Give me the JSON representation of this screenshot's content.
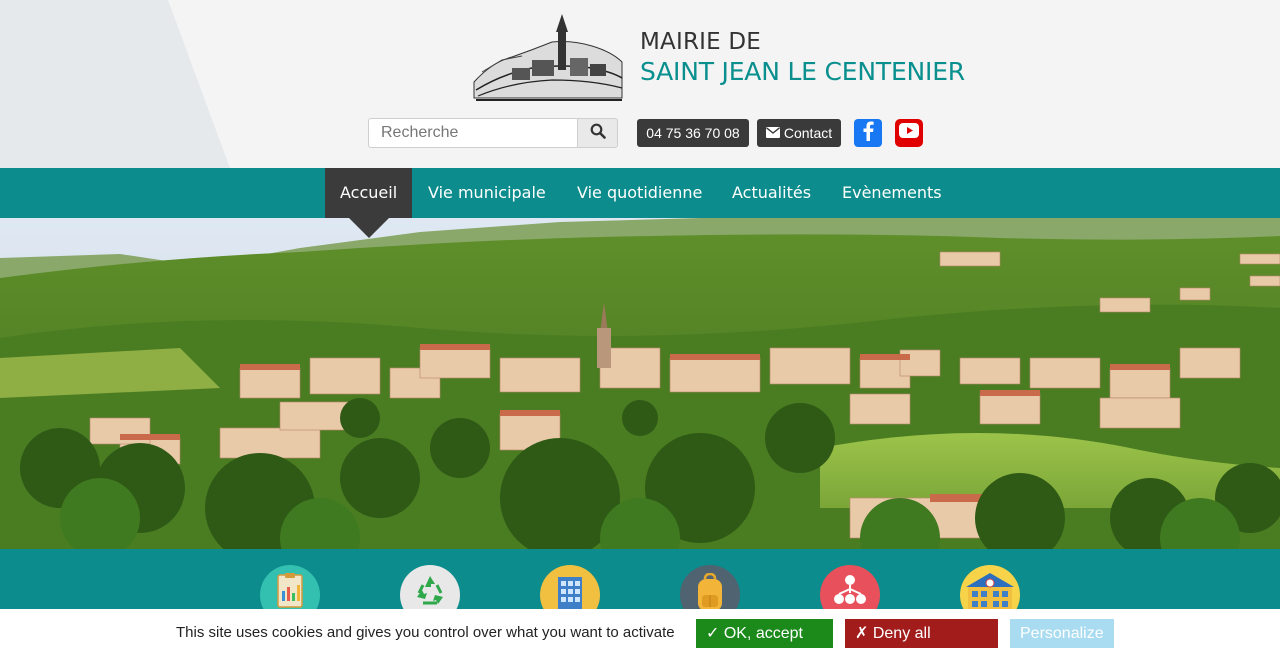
{
  "header": {
    "title_line1": "MAIRIE DE",
    "title_line2": "SAINT JEAN LE CENTENIER",
    "search_placeholder": "Recherche",
    "search_icon": "search-icon",
    "phone": "04 75 36 70 08",
    "contact_label": "Contact",
    "contact_icon": "envelope-icon",
    "facebook_icon": "facebook-icon",
    "youtube_icon": "youtube-icon"
  },
  "nav": {
    "items": [
      {
        "label": "Accueil",
        "active": true
      },
      {
        "label": "Vie municipale"
      },
      {
        "label": "Vie quotidienne"
      },
      {
        "label": "Actualités"
      },
      {
        "label": "Evènements"
      }
    ]
  },
  "quick_links": [
    {
      "icon": "report-icon",
      "color": "#34c0b0"
    },
    {
      "icon": "recycle-icon",
      "color": "#e8e8e8"
    },
    {
      "icon": "building-icon",
      "color": "#f2c040"
    },
    {
      "icon": "backpack-icon",
      "color": "#4f6470"
    },
    {
      "icon": "network-icon",
      "color": "#e8505b"
    },
    {
      "icon": "school-icon",
      "color": "#f7d34a"
    }
  ],
  "cookie": {
    "message": "This site uses cookies and gives you control over what you want to activate",
    "accept_label": "✓ OK, accept all",
    "deny_label": "✗ Deny all cookies",
    "personalize_label": "Personalize"
  },
  "colors": {
    "teal": "#0c8c8c",
    "title_teal": "#0a8f8f",
    "dark": "#3a3a3a",
    "facebook": "#1877f2",
    "youtube": "#e00000",
    "accept": "#1b8a1b",
    "deny": "#a21c1c",
    "personalize": "#a9dcf0"
  }
}
